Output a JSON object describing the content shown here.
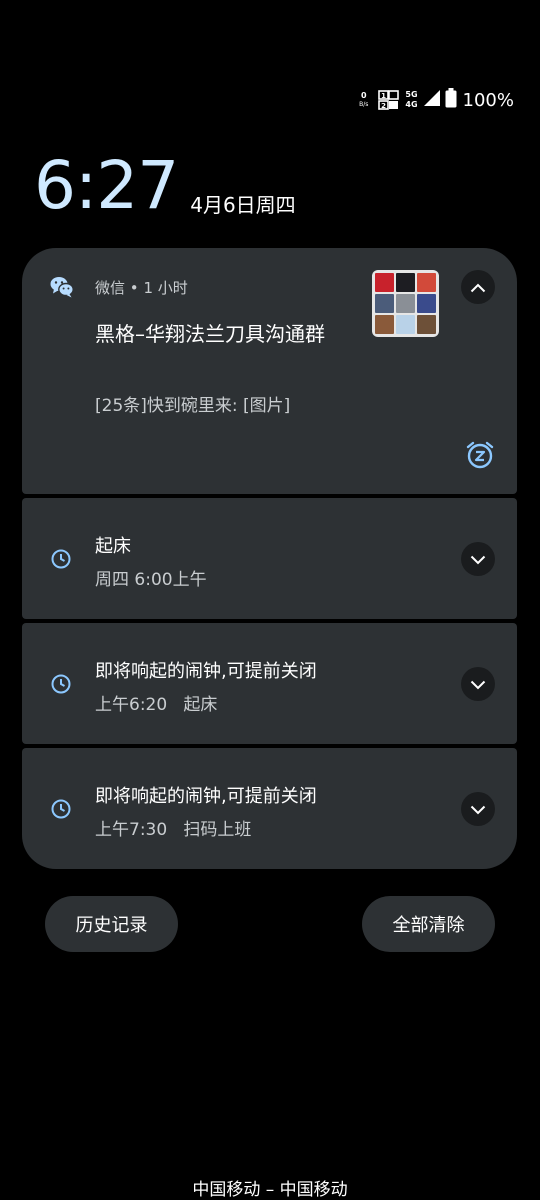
{
  "status_bar": {
    "net_speed_value": "0",
    "net_speed_unit": "B/s",
    "net_type_top": "5G",
    "net_type_bottom": "4G",
    "battery_percent": "100%"
  },
  "lockscreen": {
    "time": "6:27",
    "date": "4月6日周四"
  },
  "notifications": {
    "wechat": {
      "app_name": "微信",
      "separator": "•",
      "time_ago": "1 小时",
      "title": "黑格–华翔法兰刀具沟通群",
      "message": "[25条]快到碗里来: [图片]",
      "icon": "wechat-icon",
      "accent": "#b7dcff"
    },
    "alarm1": {
      "title": "起床",
      "text": "周四 6:00上午",
      "icon": "clock-icon"
    },
    "alarm2": {
      "title": "即将响起的闹钟,可提前关闭",
      "text": "上午6:20   起床",
      "icon": "clock-icon"
    },
    "alarm3": {
      "title": "即将响起的闹钟,可提前关闭",
      "text": "上午7:30   扫码上班",
      "icon": "clock-icon"
    }
  },
  "actions": {
    "history_label": "历史记录",
    "clear_all_label": "全部清除"
  },
  "carrier": "中国移动 – 中国移动",
  "colors": {
    "background": "#000000",
    "card": "#2d3134",
    "clock": "#cfe9ff",
    "icon_accent": "#8cc8ff"
  }
}
